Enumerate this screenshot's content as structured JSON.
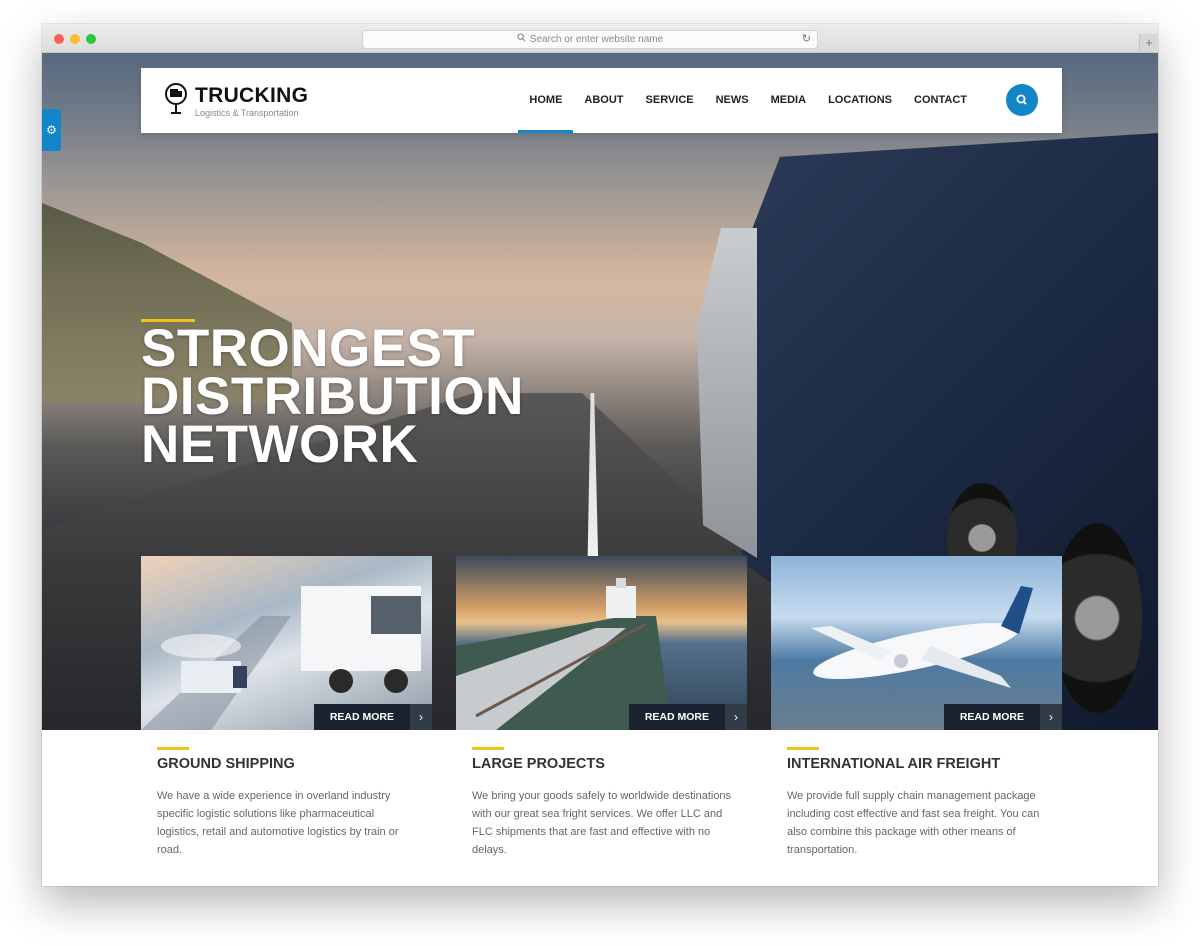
{
  "browser": {
    "address_placeholder": "Search or enter website name"
  },
  "site": {
    "logo_title": "TRUCKING",
    "logo_subtitle": "Logistics & Transportation"
  },
  "nav": {
    "items": [
      {
        "label": "HOME",
        "active": true
      },
      {
        "label": "ABOUT",
        "active": false
      },
      {
        "label": "SERVICE",
        "active": false
      },
      {
        "label": "NEWS",
        "active": false
      },
      {
        "label": "MEDIA",
        "active": false
      },
      {
        "label": "LOCATIONS",
        "active": false
      },
      {
        "label": "CONTACT",
        "active": false
      }
    ],
    "search_icon": "search-icon"
  },
  "hero": {
    "headline_lines": [
      "STRONGEST",
      "DISTRIBUTION",
      "NETWORK"
    ]
  },
  "cards": [
    {
      "image": "trucks-on-highway",
      "readmore": "READ MORE",
      "title": "GROUND SHIPPING",
      "text": "We have a wide experience in overland industry specific logistic solutions like pharmaceutical logistics, retail and automotive logistics by train or road."
    },
    {
      "image": "cargo-ship-at-sunset",
      "readmore": "READ MORE",
      "title": "LARGE PROJECTS",
      "text": "We bring your goods safely to worldwide destinations with our great sea fright services. We offer LLC and FLC shipments that are fast and effective with no delays."
    },
    {
      "image": "airplane-over-city",
      "readmore": "READ MORE",
      "title": "INTERNATIONAL AIR FREIGHT",
      "text": "We provide full supply chain management package including cost effective and fast sea freight. You can also combine this package with other means of transportation."
    }
  ],
  "colors": {
    "accent_blue": "#1386c8",
    "accent_yellow": "#f2c01a",
    "readmore_bg": "#1b2330"
  }
}
